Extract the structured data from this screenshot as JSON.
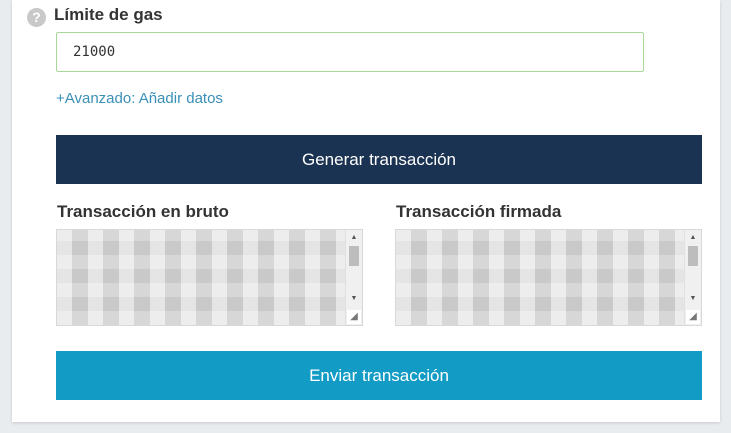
{
  "gas_limit": {
    "help_icon": "?",
    "label": "Límite de gas",
    "value": "21000"
  },
  "advanced_link": "+Avanzado: Añadir datos",
  "generate_button": "Generar transacción",
  "raw_transaction": {
    "label": "Transacción en bruto"
  },
  "signed_transaction": {
    "label": "Transacción firmada"
  },
  "send_button": "Enviar transacción",
  "colors": {
    "generate_button_bg": "#1b3352",
    "send_button_bg": "#129bc5",
    "link": "#3a8fb7",
    "input_border": "#a9d89a"
  },
  "icons": {
    "help": "question-mark-circle-icon",
    "scroll_up": "triangle-up-icon",
    "scroll_down": "triangle-down-icon",
    "resize": "resize-grip-icon"
  }
}
